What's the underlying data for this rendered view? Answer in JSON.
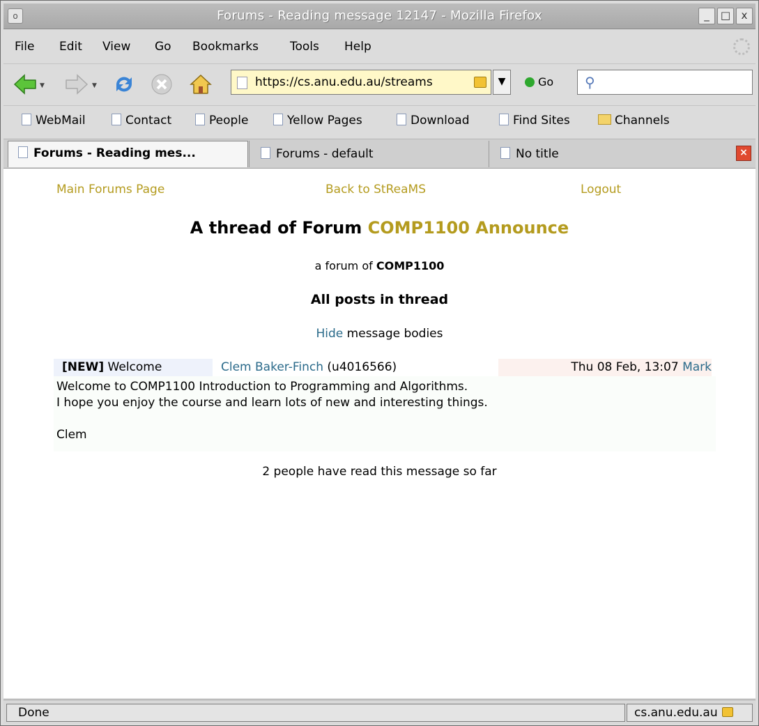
{
  "window": {
    "title": "Forums - Reading message 12147 - Mozilla Firefox",
    "controls": {
      "minimize": "_",
      "maximize": "□",
      "close": "x"
    },
    "system_button": "o"
  },
  "menu": {
    "items": [
      "File",
      "Edit",
      "View",
      "Go",
      "Bookmarks",
      "Tools",
      "Help"
    ]
  },
  "toolbar": {
    "url": "https://cs.anu.edu.au/streams",
    "go_label": "Go",
    "search_value": ""
  },
  "bookmarks": {
    "items": [
      "WebMail",
      "Contact",
      "People",
      "Yellow Pages",
      "Download",
      "Find Sites",
      "Channels"
    ]
  },
  "tabs": [
    {
      "label": "Forums - Reading mes...",
      "active": true
    },
    {
      "label": "Forums - default",
      "active": false
    },
    {
      "label": "No title",
      "active": false
    }
  ],
  "page": {
    "links": {
      "main": "Main Forums Page",
      "back": "Back to StReaMS",
      "logout": "Logout"
    },
    "heading_prefix": "A thread of Forum",
    "forum_name": "COMP1100 Announce",
    "sub_prefix": "a forum of",
    "course": "COMP1100",
    "posts_heading": "All posts in thread",
    "hide_link": "Hide",
    "hide_rest": " message bodies",
    "post": {
      "flag": "[NEW]",
      "subject": "Welcome",
      "author": "Clem Baker-Finch",
      "uid": "(u4016566)",
      "date": "Thu 08 Feb, 13:07",
      "mark": "Mark",
      "body_line1": "Welcome to COMP1100 Introduction to Programming and Algorithms.",
      "body_line2": "I hope you enjoy the course and learn lots of new and interesting things.",
      "signature": "Clem"
    },
    "read_count": "2 people have read this message so far"
  },
  "status": {
    "left": "Done",
    "right": "cs.anu.edu.au"
  },
  "colors": {
    "link_gold": "#b49b1e",
    "link_teal": "#2a6a8a"
  }
}
